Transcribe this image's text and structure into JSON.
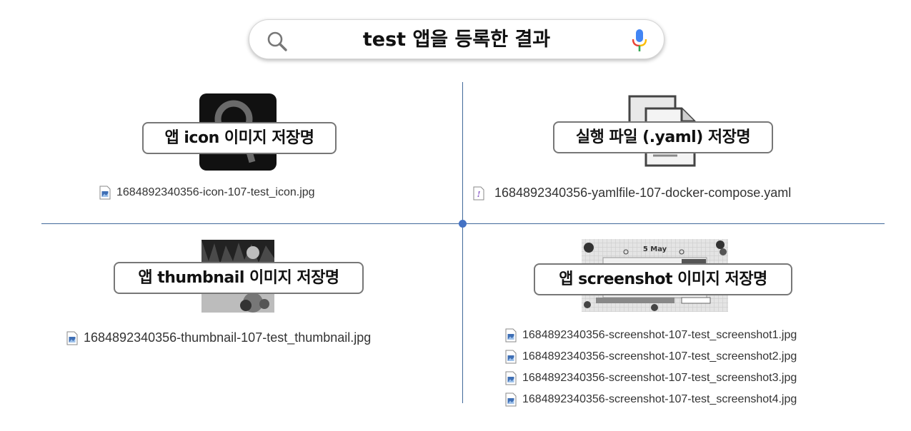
{
  "search": {
    "query": "test 앱을 등록한 결과"
  },
  "sections": {
    "icon": {
      "label": "앱 icon 이미지 저장명",
      "files": [
        "1684892340356-icon-107-test_icon.jpg"
      ]
    },
    "yaml": {
      "label": "실행 파일 (.yaml) 저장명",
      "files": [
        "1684892340356-yamlfile-107-docker-compose.yaml"
      ]
    },
    "thumbnail": {
      "label": "앱 thumbnail 이미지 저장명",
      "files": [
        "1684892340356-thumbnail-107-test_thumbnail.jpg"
      ]
    },
    "screenshot": {
      "label": "앱 screenshot 이미지 저장명",
      "preview_text": "5 May",
      "files": [
        "1684892340356-screenshot-107-test_screenshot1.jpg",
        "1684892340356-screenshot-107-test_screenshot2.jpg",
        "1684892340356-screenshot-107-test_screenshot3.jpg",
        "1684892340356-screenshot-107-test_screenshot4.jpg"
      ]
    }
  },
  "icons": {
    "search": "search-icon",
    "mic": "microphone-icon",
    "image_file": "image-file-icon",
    "yaml_file": "yaml-file-icon",
    "documents": "documents-icon"
  },
  "colors": {
    "divider": "#41699a",
    "center_dot": "#4472c4",
    "label_border": "#777777"
  }
}
